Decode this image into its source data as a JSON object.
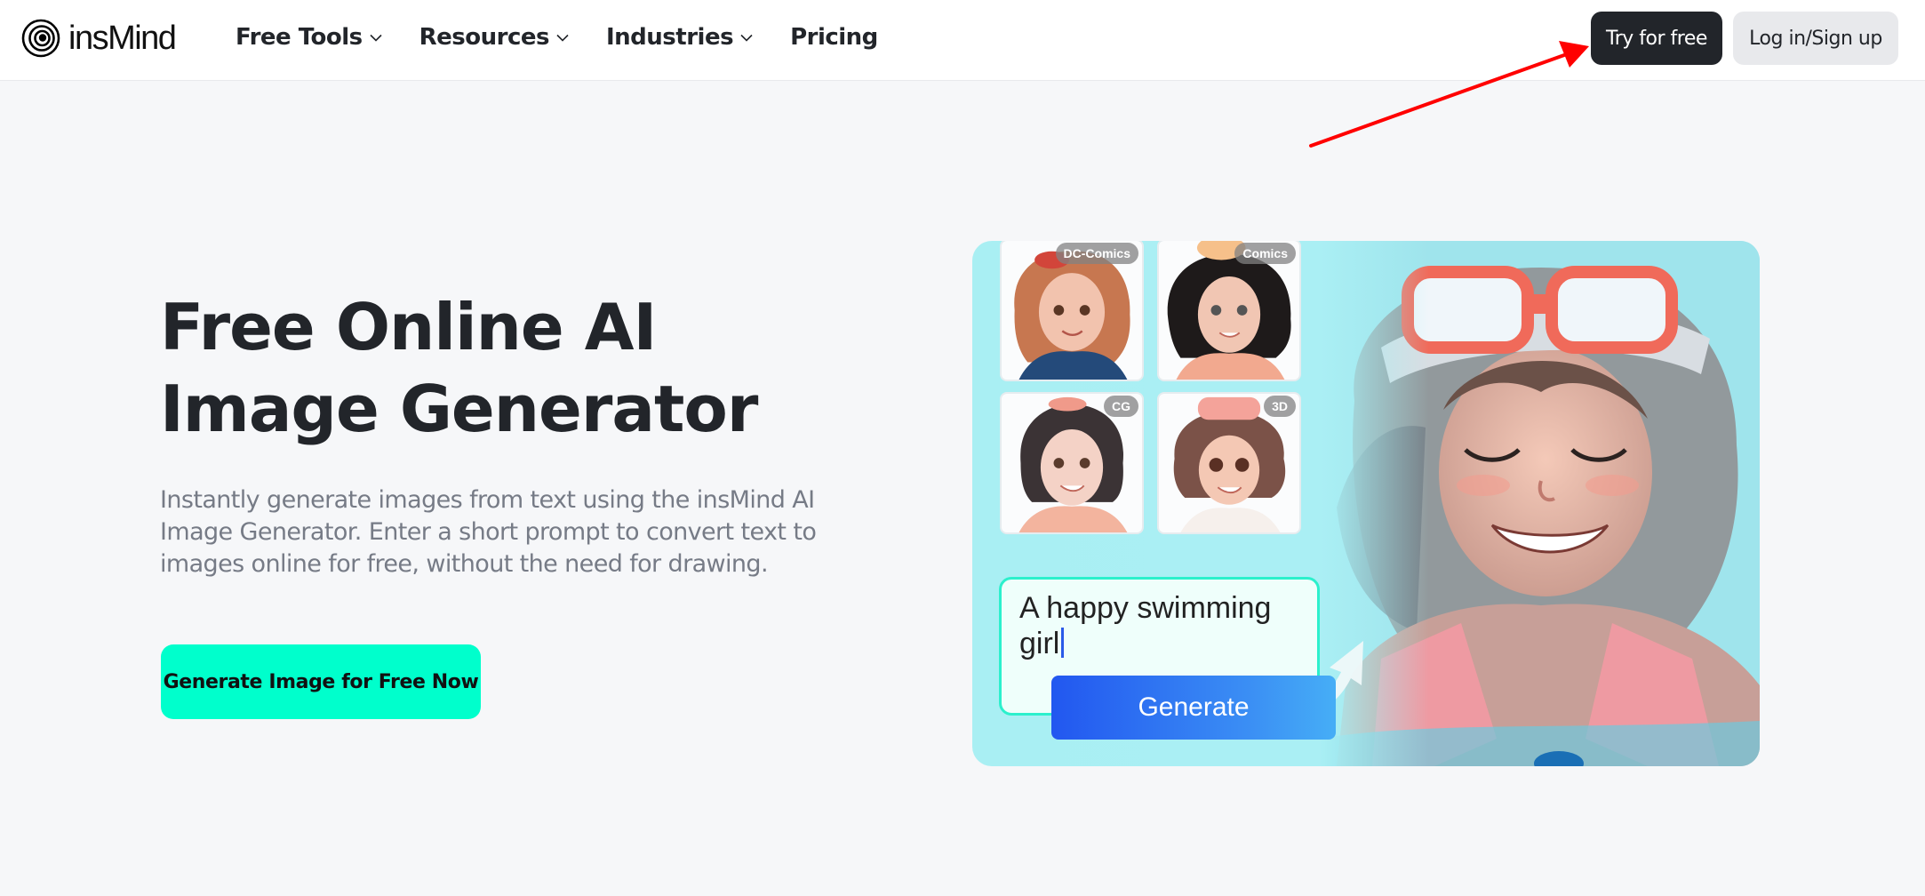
{
  "header": {
    "logo_text": "insMind",
    "nav": [
      {
        "label": "Free Tools",
        "has_dropdown": true
      },
      {
        "label": "Resources",
        "has_dropdown": true
      },
      {
        "label": "Industries",
        "has_dropdown": true
      },
      {
        "label": "Pricing",
        "has_dropdown": false
      }
    ],
    "try_button": "Try for free",
    "login_button": "Log in/Sign up"
  },
  "hero": {
    "title": "Free Online AI Image Generator",
    "description": "Instantly generate images from text using the insMind AI Image Generator. Enter a short prompt to convert text to images online for free, without the need for drawing.",
    "cta_label": "Generate Image for Free Now",
    "showcase": {
      "styles": [
        "DC-Comics",
        "Comics",
        "CG",
        "3D"
      ],
      "prompt_text": "A happy swimming girl",
      "generate_label": "Generate"
    }
  },
  "colors": {
    "accent": "#00ffcc",
    "dark_button": "#22252a",
    "light_button": "#e8e9ec",
    "page_bg": "#f6f7f9",
    "annotation_arrow": "#ff0000"
  }
}
